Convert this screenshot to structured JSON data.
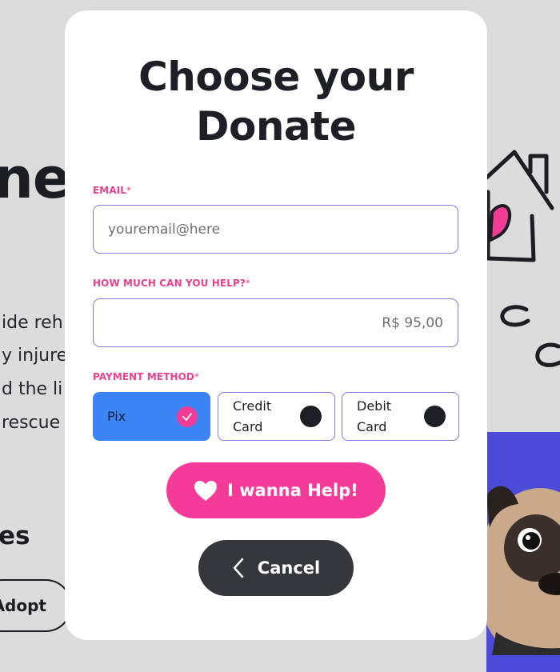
{
  "background": {
    "hero_fragment": "ne",
    "lines": [
      "ide reh",
      "y injure",
      "d the li",
      " rescue"
    ],
    "section_fragment": "es",
    "adopt_label": "Adopt"
  },
  "modal": {
    "title_line1": "Choose your",
    "title_line2": "Donate",
    "email": {
      "label": "EMAIL",
      "required_mark": "*",
      "placeholder": "youremail@here",
      "value": ""
    },
    "amount": {
      "label": "HOW MUCH CAN YOU HELP?",
      "required_mark": "*",
      "value": "R$ 95,00"
    },
    "payment": {
      "label": "PAYMENT METHOD",
      "required_mark": "*",
      "options": [
        {
          "label": "Pix",
          "selected": true
        },
        {
          "label": "Credit Card",
          "selected": false
        },
        {
          "label": "Debit Card",
          "selected": false
        }
      ]
    },
    "help_button": {
      "label": "I wanna Help!",
      "icon": "heart-icon"
    },
    "cancel_button": {
      "label": "Cancel",
      "icon": "chevron-left-icon"
    }
  },
  "colors": {
    "accent_pink": "#f53b99",
    "label_pink": "#e8418d",
    "selected_blue": "#3a84f5",
    "input_border": "#8a78e0",
    "dark_button": "#36373d",
    "backdrop": "#dcdcdc",
    "bg_card_purple": "#4c4ad8"
  }
}
